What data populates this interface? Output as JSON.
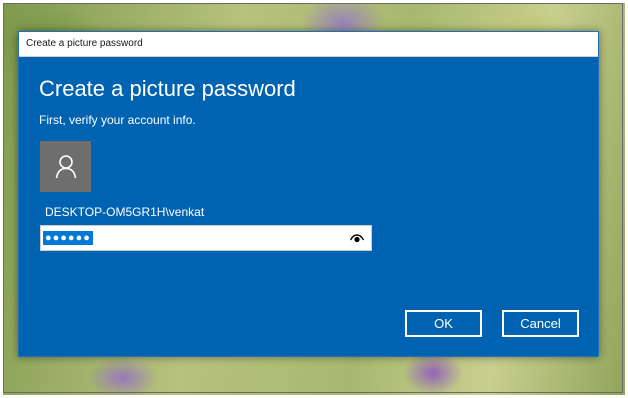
{
  "window": {
    "title": "Create a picture password"
  },
  "main": {
    "heading": "Create a picture password",
    "subheading": "First, verify your account info.",
    "account": {
      "avatar_icon": "user-silhouette-icon",
      "username": "DESKTOP-OM5GR1H\\venkat"
    },
    "password_field": {
      "masked_value": "●●●●●●",
      "reveal_icon": "eye-icon"
    }
  },
  "buttons": {
    "ok_label": "OK",
    "cancel_label": "Cancel"
  },
  "colors": {
    "dialog_background": "#0063b1",
    "selection_highlight": "#0078d7",
    "avatar_background": "#6e6e6e"
  }
}
